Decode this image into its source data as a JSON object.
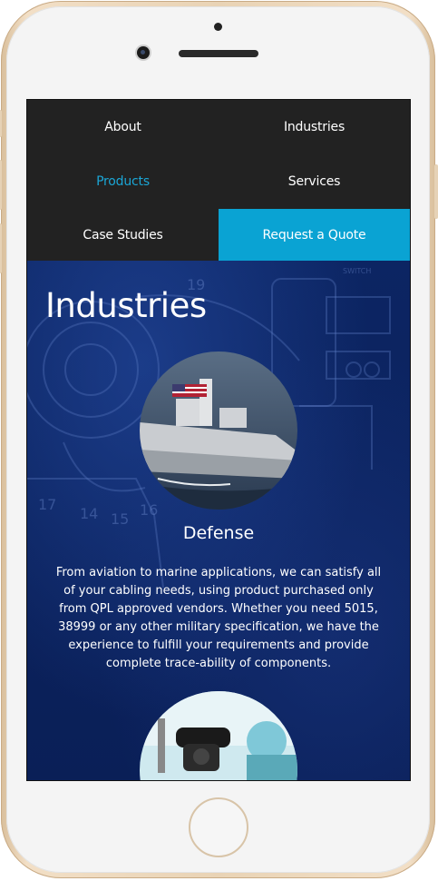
{
  "nav": {
    "items": [
      {
        "label": "About"
      },
      {
        "label": "Industries"
      },
      {
        "label": "Products"
      },
      {
        "label": "Services"
      },
      {
        "label": "Case Studies"
      },
      {
        "label": "Request a Quote"
      }
    ],
    "active": "Products",
    "cta": "Request a Quote"
  },
  "page": {
    "title": "Industries"
  },
  "industries": [
    {
      "name": "Defense",
      "image": "navy-ship-photo",
      "description": "From aviation to marine applications, we can satisfy all of your cabling needs, using product purchased only from QPL approved vendors. Whether you need 5015, 38999 or any other military specification, we have the experience to fulfill your requirements and provide complete trace-ability of components."
    },
    {
      "image": "medical-surgery-photo"
    }
  ],
  "blueprint_labels": [
    "19",
    "17",
    "14",
    "15",
    "16",
    "SWITCH"
  ],
  "colors": {
    "nav_bg": "#222222",
    "accent": "#0aa3d3",
    "active_link": "#1ba6d6",
    "hero_bg": "#0b2260",
    "frame_gold": "#e9d3b5"
  }
}
